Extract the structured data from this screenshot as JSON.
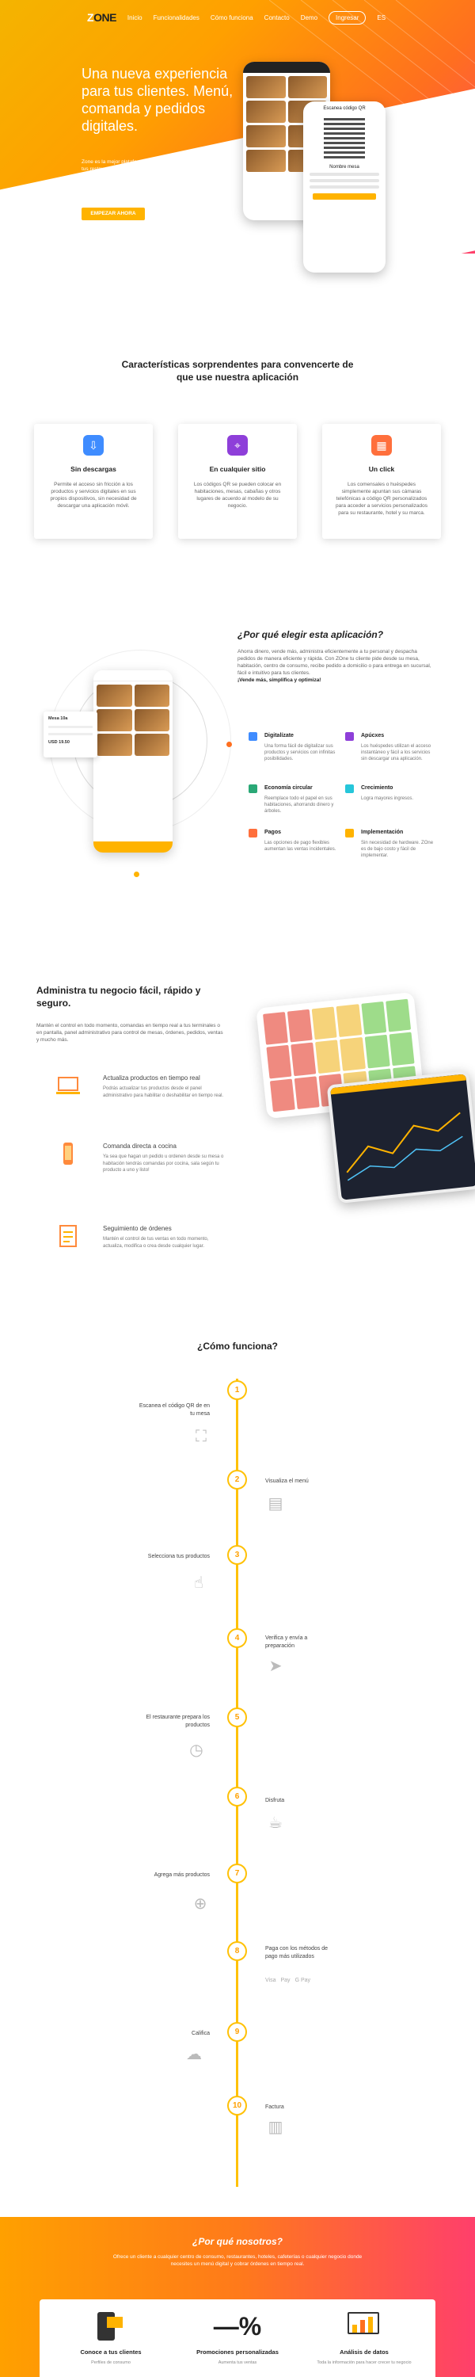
{
  "nav": {
    "logo_1": "Z",
    "logo_2": "ONE",
    "links": [
      "Inicio",
      "Funcionalidades",
      "Cómo funciona",
      "Contacto",
      "Demo"
    ],
    "button": "Ingresar",
    "lang": "ES"
  },
  "hero": {
    "title": "Una nueva experiencia para tus clientes. Menú, comanda y pedidos digitales.",
    "text": "Zone es la mejor plataforma de software para gestionar tus restaurantes, hoteles, cafeterías y mucho más. Ofrecele una experiencia personalizada y completa a tus clientes.",
    "button": "EMPEZAR AHORA",
    "phone_title": "Escanea código QR",
    "phone_small": "Nombre mesa"
  },
  "features": {
    "title": "Características sorprendentes para convencerte de que use nuestra aplicación",
    "cards": [
      {
        "title": "Sin descargas",
        "text": "Permite el acceso sin fricción a los productos y servicios digitales en sus propios dispositivos, sin necesidad de descargar una aplicación móvil.",
        "color": "#3f8cff"
      },
      {
        "title": "En cualquier sitio",
        "text": "Los códigos QR se pueden colocar en habitaciones, mesas, cabañas y otros lugares de acuerdo al modelo de su negocio.",
        "color": "#8e3fd9"
      },
      {
        "title": "Un click",
        "text": "Los comensales o huéspedes simplemente apuntan sus cámaras telefónicas a código QR personalizados para acceder a servicios personalizados para su restaurante, hotel y su marca.",
        "color": "#ff6f3c"
      }
    ]
  },
  "why": {
    "title": "¿Por qué elegir esta aplicación?",
    "text": "Ahorra dinero, vende más, administra eficientemente a tu personal y despacha pedidos de manera eficiente y rápida. Con ZOne tu cliente pide desde su mesa, habitación, centro de consumo, recibe pedido a domicilio o para entrega en sucursal, fácil e intuitivo para tus clientes.",
    "text_bold": "¡Vende más, simplifica y optimiza!",
    "phone": {
      "label1": "Mesa 10a",
      "price": "USD 19.50"
    },
    "features": [
      {
        "title": "Digitalízate",
        "text": "Una forma fácil de digitalizar sus productos y servicios con infinitas posibilidades.",
        "color": "#3f8cff"
      },
      {
        "title": "Apúcxes",
        "text": "Los huéspedes utilizan el acceso instantáneo y fácil a los servicios sin descargar una aplicación.",
        "color": "#8e3fd9"
      },
      {
        "title": "Economía circular",
        "text": "Reemplace todo el papel en sus habitaciones, ahorrando dinero y árboles.",
        "color": "#2aa876"
      },
      {
        "title": "Crecimiento",
        "text": "Logra mayores ingresos.",
        "color": "#26c6da"
      },
      {
        "title": "Pagos",
        "text": "Las opciones de pago flexibles aumentan las ventas incidentales.",
        "color": "#ff6f3c"
      },
      {
        "title": "Implementación",
        "text": "Sin necesidad de hardware. ZOne es de bajo costo y fácil de implementar.",
        "color": "#ffb300"
      }
    ]
  },
  "manage": {
    "title": "Administra tu negocio fácil, rápido y seguro.",
    "text": "Mantén el control en todo momento, comandas en tiempo real a tus terminales o en pantalla, panel administrativo para control de mesas, órdenes, pedidos, ventas y mucho más.",
    "items": [
      {
        "title": "Actualiza productos en tiempo real",
        "text": "Podrás actualizar tus productos desde el panel administrativo para habilitar o deshabilitar en tiempo real."
      },
      {
        "title": "Comanda directa a cocina",
        "text": "Ya sea que hagan un pedido u ordenen desde su mesa o habitación tendrás comandas por cocina, sala según tu producto a uno y listo!"
      },
      {
        "title": "Seguimiento de órdenes",
        "text": "Mantén el control de tus ventas en todo momento, actualiza, modifica o crea desde cualquier lugar."
      }
    ]
  },
  "how": {
    "title": "¿Cómo funciona?",
    "steps": [
      {
        "num": "1",
        "text": "Escanea el código QR de en tu mesa",
        "icon": "scan-icon",
        "glyph": "⛶"
      },
      {
        "num": "2",
        "text": "Visualiza el menú",
        "icon": "menu-icon",
        "glyph": "▤"
      },
      {
        "num": "3",
        "text": "Selecciona tus productos",
        "icon": "tap-icon",
        "glyph": "☝"
      },
      {
        "num": "4",
        "text": "Verifica y envía a preparación",
        "icon": "send-icon",
        "glyph": "➤"
      },
      {
        "num": "5",
        "text": "El restaurante prepara los productos",
        "icon": "clock-icon",
        "glyph": "◷"
      },
      {
        "num": "6",
        "text": "Disfruta",
        "icon": "enjoy-icon",
        "glyph": "☕"
      },
      {
        "num": "7",
        "text": "Agrega más productos",
        "icon": "add-icon",
        "glyph": "⊕"
      },
      {
        "num": "8",
        "text": "Paga con los métodos de pago más utilizados",
        "icon": "payment-icon",
        "glyph": "",
        "payments": [
          "Visa",
          " Pay",
          "G Pay"
        ]
      },
      {
        "num": "9",
        "text": "Califica",
        "icon": "rating-icon",
        "glyph": "☁"
      },
      {
        "num": "10",
        "text": "Factura",
        "icon": "invoice-icon",
        "glyph": "▥"
      }
    ]
  },
  "whyus": {
    "title": "¿Por qué nosotros?",
    "text": "Ofrece un cliente a cualquier centro de consumo, restaurantes, hoteles, cafeterías o cualquier negocio donde necesites un menú digital y cobrar órdenes en tiempo real.",
    "items": [
      {
        "title": "Conoce a tus clientes",
        "text": "Perfiles de consumo"
      },
      {
        "title": "Promociones personalizadas",
        "text": "Aumenta tus ventas"
      },
      {
        "title": "Análisis de datos",
        "text": "Toda la información para hacer crecer tu negocio"
      }
    ]
  },
  "colors": {
    "accent": "#ffb300",
    "orange": "#ff6f1f",
    "pink": "#ff3f6b"
  }
}
